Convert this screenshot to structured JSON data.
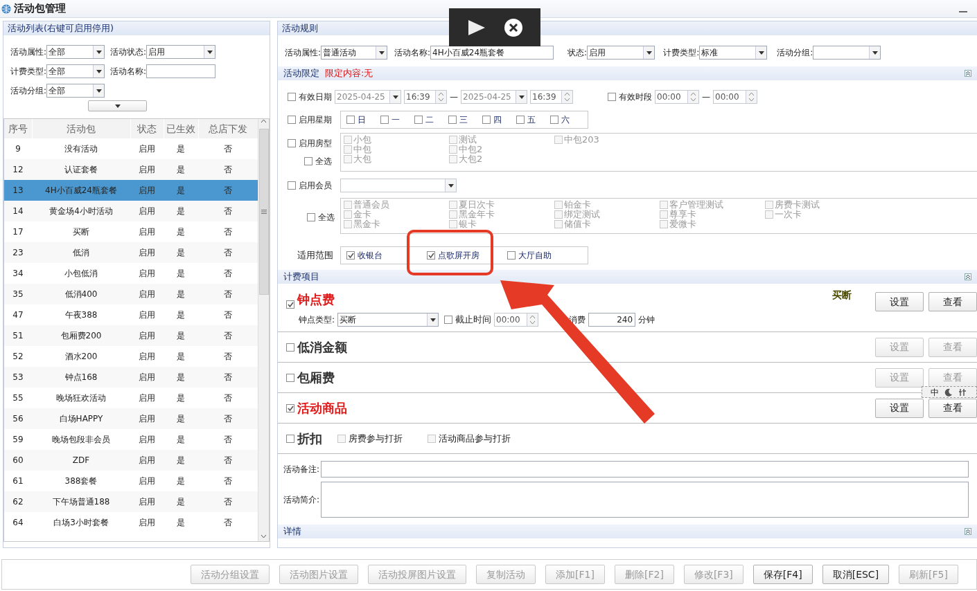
{
  "window": {
    "title": "活动包管理"
  },
  "ime_bar": {
    "mode": "中"
  },
  "activity_list": {
    "header": "活动列表(右键可启用停用)",
    "filters": [
      {
        "label": "活动属性:",
        "value": "全部",
        "kind": "select"
      },
      {
        "label": "活动状态:",
        "value": "启用",
        "kind": "select"
      },
      {
        "label": "计费类型:",
        "value": "全部",
        "kind": "select"
      },
      {
        "label": "活动名称:",
        "kind": "input"
      },
      {
        "label": "活动分组:",
        "value": "全部",
        "kind": "select"
      }
    ],
    "columns": [
      "序号",
      "活动包",
      "状态",
      "已生效",
      "总店下发"
    ],
    "rows": [
      {
        "cells": [
          "9",
          "没有活动",
          "启用",
          "是",
          "否"
        ],
        "selected": false
      },
      {
        "cells": [
          "12",
          "认证套餐",
          "启用",
          "是",
          "否"
        ],
        "selected": false
      },
      {
        "cells": [
          "13",
          "4H小百威24瓶套餐",
          "启用",
          "是",
          "否"
        ],
        "selected": true
      },
      {
        "cells": [
          "14",
          "黄金场4小时活动",
          "启用",
          "是",
          "否"
        ],
        "selected": false
      },
      {
        "cells": [
          "17",
          "买断",
          "启用",
          "是",
          "否"
        ],
        "selected": false
      },
      {
        "cells": [
          "23",
          "低消",
          "启用",
          "是",
          "否"
        ],
        "selected": false
      },
      {
        "cells": [
          "34",
          "小包低消",
          "启用",
          "是",
          "否"
        ],
        "selected": false
      },
      {
        "cells": [
          "35",
          "低消400",
          "启用",
          "是",
          "否"
        ],
        "selected": false
      },
      {
        "cells": [
          "47",
          "午夜388",
          "启用",
          "是",
          "否"
        ],
        "selected": false
      },
      {
        "cells": [
          "51",
          "包厢费200",
          "启用",
          "是",
          "否"
        ],
        "selected": false
      },
      {
        "cells": [
          "52",
          "酒水200",
          "启用",
          "是",
          "否"
        ],
        "selected": false
      },
      {
        "cells": [
          "53",
          "钟点168",
          "启用",
          "是",
          "否"
        ],
        "selected": false
      },
      {
        "cells": [
          "55",
          "晚场狂欢活动",
          "启用",
          "是",
          "否"
        ],
        "selected": false
      },
      {
        "cells": [
          "56",
          "白场HAPPY",
          "启用",
          "是",
          "否"
        ],
        "selected": false
      },
      {
        "cells": [
          "59",
          "晚场包段非会员",
          "启用",
          "是",
          "否"
        ],
        "selected": false
      },
      {
        "cells": [
          "60",
          "ZDF",
          "启用",
          "是",
          "否"
        ],
        "selected": false
      },
      {
        "cells": [
          "61",
          "388套餐",
          "启用",
          "是",
          "否"
        ],
        "selected": false
      },
      {
        "cells": [
          "62",
          "下午场普通188",
          "启用",
          "是",
          "否"
        ],
        "selected": false
      },
      {
        "cells": [
          "64",
          "白场3小时套餐",
          "启用",
          "是",
          "否"
        ],
        "selected": false
      }
    ]
  },
  "rules": {
    "header": "活动规则",
    "fields": [
      {
        "label": "活动属性:",
        "value": "普通活动",
        "kind": "select"
      },
      {
        "label": "活动名称:",
        "value": "4H小百威24瓶套餐",
        "kind": "input"
      },
      {
        "label": "状态:",
        "value": "启用",
        "kind": "select"
      },
      {
        "label": "计费类型:",
        "value": "标准",
        "kind": "select"
      },
      {
        "label": "活动分组:",
        "kind": "select"
      }
    ]
  },
  "limits": {
    "title": "活动限定",
    "note": "限定内容:无",
    "valid_date": {
      "label": "有效日期",
      "checked": false,
      "start_date": "2025-04-25",
      "start_time": "16:39",
      "separator": "—",
      "end_date": "2025-04-25",
      "end_time": "16:39"
    },
    "valid_period": {
      "label": "有效时段",
      "checked": false,
      "start": "00:00",
      "separator": "—",
      "end": "00:00"
    },
    "weekdays": {
      "label": "启用星期",
      "checked": false,
      "days": [
        {
          "label": "日",
          "checked": false
        },
        {
          "label": "一",
          "checked": false
        },
        {
          "label": "二",
          "checked": false
        },
        {
          "label": "三",
          "checked": false
        },
        {
          "label": "四",
          "checked": false
        },
        {
          "label": "五",
          "checked": false
        },
        {
          "label": "六",
          "checked": false
        }
      ]
    },
    "room_types": {
      "label": "启用房型",
      "checked": false,
      "disabled": true,
      "select_all": {
        "label": "全选",
        "checked": false
      },
      "columns": [
        [
          {
            "label": "小包",
            "checked": false
          },
          {
            "label": "中包",
            "checked": false
          },
          {
            "label": "大包",
            "checked": false
          }
        ],
        [
          {
            "label": "测试",
            "checked": false
          },
          {
            "label": "中包2",
            "checked": false
          },
          {
            "label": "大包2",
            "checked": false
          }
        ],
        [
          {
            "label": "中包203",
            "checked": false
          }
        ]
      ]
    },
    "members": {
      "label": "启用会员",
      "checked": false,
      "disabled": true,
      "select_all": {
        "label": "全选",
        "checked": false
      },
      "columns": [
        [
          {
            "label": "普通会员",
            "checked": false
          },
          {
            "label": "金卡",
            "checked": false
          },
          {
            "label": "黑金卡",
            "checked": false
          }
        ],
        [
          {
            "label": "夏日次卡",
            "checked": false
          },
          {
            "label": "黑金年卡",
            "checked": false
          },
          {
            "label": "银卡",
            "checked": false
          }
        ],
        [
          {
            "label": "铂金卡",
            "checked": false
          },
          {
            "label": "绑定测试",
            "checked": false
          },
          {
            "label": "储值卡",
            "checked": false
          }
        ],
        [
          {
            "label": "客户管理测试",
            "checked": false
          },
          {
            "label": "尊享卡",
            "checked": false
          },
          {
            "label": "爱微卡",
            "checked": false
          }
        ],
        [
          {
            "label": "房费卡测试",
            "checked": false
          },
          {
            "label": "一次卡",
            "checked": false
          }
        ]
      ]
    },
    "scope": {
      "label": "适用范围",
      "options": [
        {
          "label": "收银台",
          "checked": true
        },
        {
          "label": "点歌屏开房",
          "checked": true
        },
        {
          "label": "大厅自助",
          "checked": false
        }
      ]
    }
  },
  "billing": {
    "title": "计费项目",
    "items": [
      {
        "label": "钟点费",
        "checked": true,
        "note": "买断",
        "buttons": [
          {
            "label": "设置",
            "disabled": false
          },
          {
            "label": "查看",
            "disabled": false
          }
        ]
      },
      {
        "label": "低消金额",
        "checked": false,
        "buttons": [
          {
            "label": "设置",
            "disabled": true
          },
          {
            "label": "查看",
            "disabled": true
          }
        ]
      },
      {
        "label": "包厢费",
        "checked": false,
        "buttons": [
          {
            "label": "设置",
            "disabled": true
          },
          {
            "label": "查看",
            "disabled": true
          }
        ]
      },
      {
        "label": "活动商品",
        "checked": true,
        "buttons": [
          {
            "label": "设置",
            "disabled": false
          },
          {
            "label": "查看",
            "disabled": false
          }
        ]
      }
    ],
    "hourly": {
      "type_label": "钟点类型:",
      "type_value": "买断",
      "cutoff": {
        "label": "截止时间",
        "checked": false,
        "value": "00:00"
      },
      "consume_label": "消费",
      "consume_value": "240",
      "unit": "分钟"
    },
    "discount": {
      "label": "折扣",
      "checked": false,
      "options": [
        {
          "label": "房费参与打折",
          "checked": false
        },
        {
          "label": "活动商品参与打折",
          "checked": false
        }
      ]
    }
  },
  "remark": {
    "label": "活动备注:"
  },
  "intro": {
    "label": "活动简介:"
  },
  "details": {
    "title": "详情"
  },
  "footer_buttons": [
    {
      "label": "活动分组设置",
      "disabled": true
    },
    {
      "label": "活动图片设置",
      "disabled": true
    },
    {
      "label": "活动投屏图片设置",
      "disabled": true
    },
    {
      "label": "复制活动",
      "disabled": true
    },
    {
      "label": "添加[F1]",
      "disabled": true
    },
    {
      "label": "删除[F2]",
      "disabled": true
    },
    {
      "label": "修改[F3]",
      "disabled": true
    },
    {
      "label": "保存[F4]",
      "disabled": false
    },
    {
      "label": "取消[ESC]",
      "disabled": false
    },
    {
      "label": "刷新[F5]",
      "disabled": true
    }
  ]
}
